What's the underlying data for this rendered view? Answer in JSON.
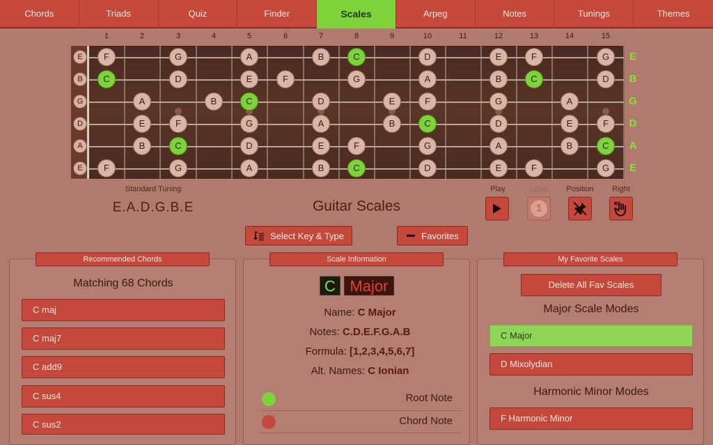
{
  "tabs": [
    "Chords",
    "Triads",
    "Quiz",
    "Finder",
    "Scales",
    "Arpeg",
    "Notes",
    "Tunings",
    "Themes"
  ],
  "active_tab": "Scales",
  "fret_numbers": [
    "1",
    "2",
    "3",
    "4",
    "5",
    "6",
    "7",
    "8",
    "9",
    "10",
    "11",
    "12",
    "13",
    "14",
    "15"
  ],
  "strings": [
    {
      "open": "E",
      "label": "E",
      "notes": [
        "F",
        "",
        "G",
        "",
        "A",
        "",
        "B",
        "C",
        "",
        "D",
        "",
        "E",
        "F",
        "",
        "G"
      ]
    },
    {
      "open": "B",
      "label": "B",
      "notes": [
        "C",
        "",
        "D",
        "",
        "E",
        "F",
        "",
        "G",
        "",
        "A",
        "",
        "B",
        "C",
        "",
        "D"
      ]
    },
    {
      "open": "G",
      "label": "G",
      "notes": [
        "",
        "A",
        "",
        "B",
        "C",
        "",
        "D",
        "",
        "E",
        "F",
        "",
        "G",
        "",
        "A",
        ""
      ]
    },
    {
      "open": "D",
      "label": "D",
      "notes": [
        "",
        "E",
        "F",
        "",
        "G",
        "",
        "A",
        "",
        "B",
        "C",
        "",
        "D",
        "",
        "E",
        "F"
      ]
    },
    {
      "open": "A",
      "label": "A",
      "notes": [
        "",
        "B",
        "C",
        "",
        "D",
        "",
        "E",
        "F",
        "",
        "G",
        "",
        "A",
        "",
        "B",
        "C"
      ]
    },
    {
      "open": "E",
      "label": "E",
      "notes": [
        "F",
        "",
        "G",
        "",
        "A",
        "",
        "B",
        "C",
        "",
        "D",
        "",
        "E",
        "F",
        "",
        "G"
      ]
    }
  ],
  "root_note": "C",
  "tuning_label": "Standard Tuning",
  "tuning_value": "E.A.D.G.B.E",
  "page_title": "Guitar Scales",
  "controls": {
    "play_label": "Play",
    "label_label": "Label",
    "label_value": "1",
    "position_label": "Position",
    "right_label": "Right"
  },
  "actions": {
    "select_key_type": "Select Key & Type",
    "favorites": "Favorites"
  },
  "recommended": {
    "header": "Recommended Chords",
    "subtitle": "Matching 68 Chords",
    "items": [
      "C maj",
      "C maj7",
      "C add9",
      "C sus4",
      "C sus2"
    ]
  },
  "scale_info": {
    "header": "Scale Information",
    "key": "C",
    "type": "Major",
    "name_label": "Name:",
    "name_value": "C Major",
    "notes_label": "Notes:",
    "notes_value": "C.D.E.F.G.A.B",
    "formula_label": "Formula:",
    "formula_value": "[1,2,3,4,5,6,7]",
    "alt_label": "Alt. Names:",
    "alt_value": "C Ionian",
    "legend_root": "Root Note",
    "legend_chord": "Chord Note"
  },
  "favorites": {
    "header": "My Favorite Scales",
    "delete_all": "Delete All Fav Scales",
    "group1_title": "Major Scale Modes",
    "group1_items": [
      "C Major",
      "D Mixolydian"
    ],
    "group2_title": "Harmonic Minor Modes",
    "group2_items": [
      "F Harmonic Minor"
    ]
  },
  "colors": {
    "accent": "#c4483c",
    "active_green": "#7fd23c",
    "background": "#b17a6e"
  }
}
